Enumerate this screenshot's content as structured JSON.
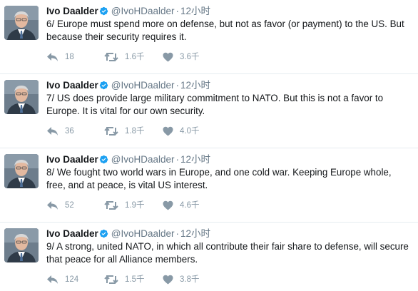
{
  "colors": {
    "accent": "#1da1f2",
    "muted": "#657786",
    "icon": "#8899a6",
    "divider": "#e6ecf0"
  },
  "tweets": [
    {
      "name": "Ivo Daalder",
      "handle": "@IvoHDaalder",
      "time": "12小时",
      "text": "6/ Europe must spend more on defense, but not as favor (or payment) to the US. But because their security requires it.",
      "replies": "18",
      "retweets": "1.6千",
      "likes": "3.6千"
    },
    {
      "name": "Ivo Daalder",
      "handle": "@IvoHDaalder",
      "time": "12小时",
      "text": "7/ US does provide large military commitment to NATO. But this is not a favor to Europe. It is vital for our own security.",
      "replies": "36",
      "retweets": "1.8千",
      "likes": "4.0千"
    },
    {
      "name": "Ivo Daalder",
      "handle": "@IvoHDaalder",
      "time": "12小时",
      "text": "8/ We fought two world wars in Europe, and one cold war. Keeping Europe whole, free, and at peace, is vital US interest.",
      "replies": "52",
      "retweets": "1.9千",
      "likes": "4.6千"
    },
    {
      "name": "Ivo Daalder",
      "handle": "@IvoHDaalder",
      "time": "12小时",
      "text": "9/ A strong, united NATO, in which all contribute their fair share to defense, will secure that peace for all Alliance members.",
      "replies": "124",
      "retweets": "1.5千",
      "likes": "3.8千"
    }
  ]
}
